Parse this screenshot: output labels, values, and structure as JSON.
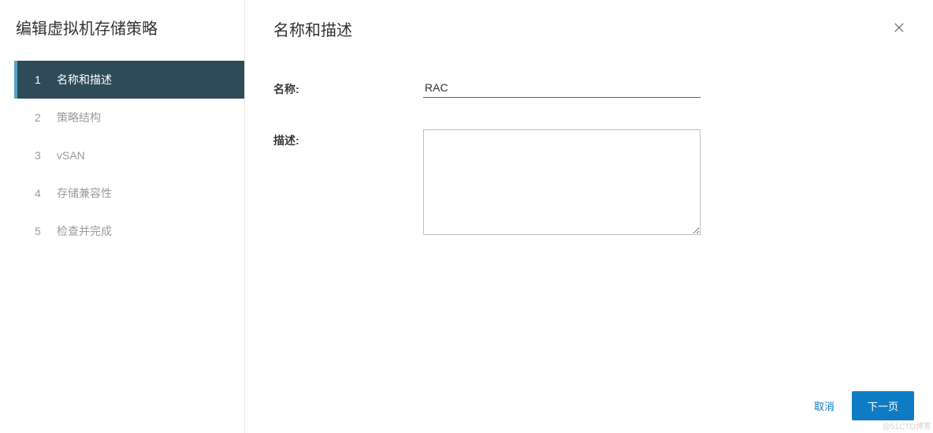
{
  "sidebar": {
    "title": "编辑虚拟机存储策略",
    "steps": [
      {
        "num": "1",
        "label": "名称和描述",
        "active": true
      },
      {
        "num": "2",
        "label": "策略结构",
        "active": false
      },
      {
        "num": "3",
        "label": "vSAN",
        "active": false
      },
      {
        "num": "4",
        "label": "存储兼容性",
        "active": false
      },
      {
        "num": "5",
        "label": "检查并完成",
        "active": false
      }
    ]
  },
  "main": {
    "title": "名称和描述",
    "name_label": "名称:",
    "name_value": "RAC",
    "desc_label": "描述:",
    "desc_value": ""
  },
  "footer": {
    "cancel": "取消",
    "next": "下一页"
  },
  "watermark": "@51CTO博客"
}
